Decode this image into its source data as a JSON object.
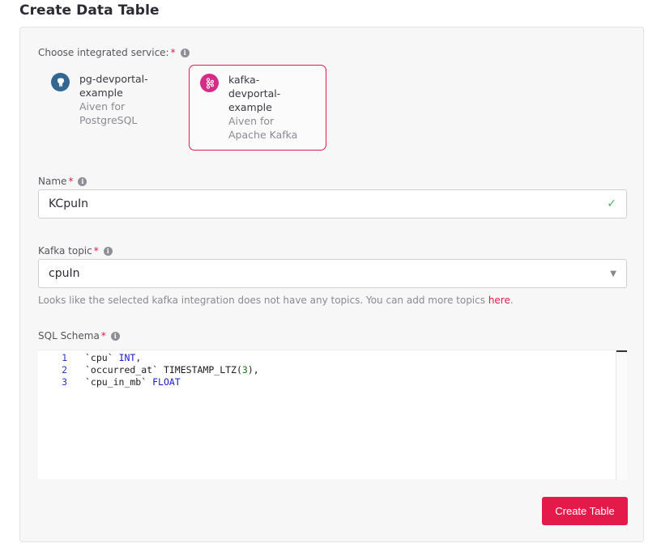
{
  "page": {
    "title": "Create Data Table"
  },
  "service_section": {
    "label": "Choose integrated service:",
    "required_mark": "*",
    "info_glyph": "i",
    "services": [
      {
        "name_line1": "pg-devportal-",
        "name_line2": "example",
        "type_line1": "Aiven for",
        "type_line2": "PostgreSQL",
        "icon": "postgresql-elephant-icon",
        "icon_color": "#336791",
        "selected": false
      },
      {
        "name_line1": "kafka-",
        "name_line2": "devportal-",
        "name_line3": "example",
        "type_line1": "Aiven for",
        "type_line2": "Apache Kafka",
        "icon": "kafka-icon",
        "icon_color": "#d42c87",
        "selected": true
      }
    ]
  },
  "name_field": {
    "label": "Name",
    "required_mark": "*",
    "info_glyph": "i",
    "value": "KCpuIn",
    "valid_glyph": "✓"
  },
  "topic_field": {
    "label": "Kafka topic",
    "required_mark": "*",
    "info_glyph": "i",
    "value": "cpuIn",
    "caret": "▼",
    "helper_text": "Looks like the selected kafka integration does not have any topics. You can add more topics ",
    "helper_link": "here",
    "helper_period": "."
  },
  "schema_field": {
    "label": "SQL Schema",
    "required_mark": "*",
    "info_glyph": "i",
    "lines": [
      {
        "num": "1",
        "name": "`cpu`",
        "type": "INT",
        "suffix": ","
      },
      {
        "num": "2",
        "name": "`occurred_at`",
        "type": "TIMESTAMP_LTZ(",
        "arg": "3",
        "suffix": "),"
      },
      {
        "num": "3",
        "name": "`cpu_in_mb`",
        "type": "FLOAT",
        "suffix": ""
      }
    ]
  },
  "actions": {
    "create_label": "Create Table"
  },
  "colors": {
    "accent": "#e41a4a",
    "valid": "#3cb45a"
  }
}
